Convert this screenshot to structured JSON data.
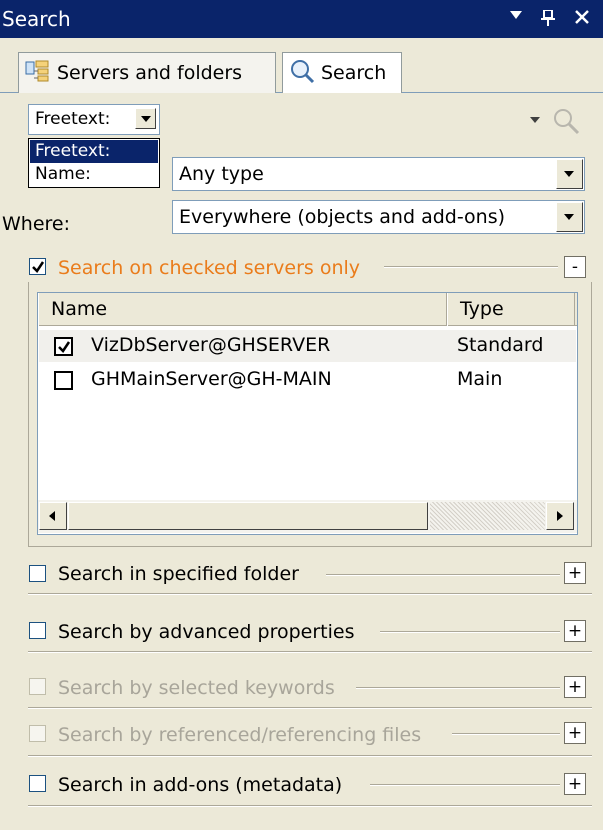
{
  "window": {
    "title": "Search",
    "controls": [
      "pin-down-arrow",
      "pin",
      "close"
    ]
  },
  "tabs": [
    {
      "label": "Servers and folders",
      "icon": "servers-folders-icon",
      "active": false
    },
    {
      "label": "Search",
      "icon": "magnifier-icon",
      "active": true
    }
  ],
  "search": {
    "mode_value": "Freetext:",
    "input_value": "",
    "mode_options": [
      {
        "label": "Freetext:",
        "selected": true
      },
      {
        "label": "Name:",
        "selected": false
      }
    ]
  },
  "filters": {
    "type_value": "Any type",
    "where_label": "Where:",
    "where_value": "Everywhere (objects and add-ons)"
  },
  "sections": {
    "checked_servers": {
      "label": "Search on checked servers only",
      "checked": true,
      "expander": "-"
    },
    "specified_folder": {
      "label": "Search in specified folder",
      "checked": false,
      "expander": "+"
    },
    "advanced_properties": {
      "label": "Search by advanced properties",
      "checked": false,
      "expander": "+"
    },
    "selected_keywords": {
      "label": "Search by selected keywords",
      "checked": false,
      "enabled": false,
      "expander": "+"
    },
    "referenced_files": {
      "label": "Search by referenced/referencing files",
      "checked": false,
      "enabled": false,
      "expander": "+"
    },
    "addons_metadata": {
      "label": "Search in add-ons (metadata)",
      "checked": false,
      "expander": "+"
    }
  },
  "servers_table": {
    "columns": [
      "Name",
      "Type"
    ],
    "rows": [
      {
        "name": "VizDbServer@GHSERVER",
        "type": "Standard",
        "checked": true
      },
      {
        "name": "GHMainServer@GH-MAIN",
        "type": "Main",
        "checked": false
      }
    ]
  },
  "colors": {
    "titlebar": "#0a246a",
    "panel": "#ece9d8",
    "accent_orange": "#ea7c1b",
    "disabled_text": "#a8a59a"
  }
}
